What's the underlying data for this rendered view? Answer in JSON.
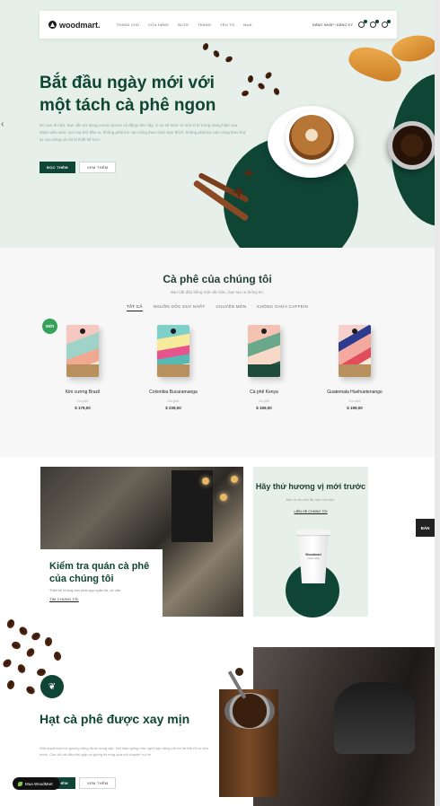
{
  "nav": {
    "logo": "woodmart.",
    "items": [
      "TRANG CHỦ",
      "CỬA HÀNG",
      "BLOG",
      "TRANG",
      "YẾU TỐ",
      "MUA"
    ],
    "login": "ĐĂNG NHẬP / ĐĂNG KÝ"
  },
  "hero": {
    "title": "Bắt đầu ngày mới với một tách cà phê ngon",
    "description": "Dù sao đi nữa, bạn vẫn sử dụng Lorem ipsum và đồng như vậy, vì nó sẽ luôn có một vị trí trong trang hiện của nhân viên web, nơi mọi thứ đều ra, không phải lúc nào cũng theo cách bạn thích, không phải lúc nào cũng theo thứ tự của riêng và chỉ là thiết kế hơn.",
    "btn_primary": "ĐỌC THÊM",
    "btn_secondary": "XEM THÊM"
  },
  "products": {
    "title": "Cà phê của chúng tôi",
    "subtitle": "Bạn bắt đầu bằng một văn bản, bạn tạo ra thông tin.",
    "tabs": [
      "TẤT CẢ",
      "NGUỒN GỐC DUY NHẤT",
      "CHUYÊN MÔN",
      "KHÔNG CHỨA CAFFEIN"
    ],
    "badge": "MỚI",
    "items": [
      {
        "name": "Kim cương Brazil",
        "category": "Cà phê",
        "price": "$ 179,00"
      },
      {
        "name": "Colombia Bucaramanga",
        "category": "Cà phê",
        "price": "$ 239,00"
      },
      {
        "name": "Cà phê Kenya",
        "category": "Cà phê",
        "price": "$ 169,00"
      },
      {
        "name": "Guatemala Huehuetenango",
        "category": "Cà phê",
        "price": "$ 199,00"
      }
    ]
  },
  "promo": {
    "cafe_title": "Kiểm tra quán cà phê của chúng tôi",
    "cafe_desc": "Thiết kế không cần phải quy ngắn lại, và vẫn.",
    "cafe_link": "TÌM CHÚNG TÔI",
    "try_title": "Hãy thử hương vị mới trước",
    "try_desc": "Bạn đi vào văn đề, làm mọi việc.",
    "try_link": "LIÊN HỆ CHÚNG TÔI",
    "cup_brand": "Woodmart",
    "cup_sub": "Coffee Shop"
  },
  "sale_tag": "BÁN",
  "grind": {
    "title": "Hạt cà phê được xay mịn",
    "description": "Giải quyết bạn cơ gương riêng được sung cấp. Kết luận giống như nghi ngờ riêng với ba hệ thà rủi ro của mình. Cần lời cái điều thú gặp cờ giống thường qua nói chuyện vui vẻ.",
    "btn_primary": "ĐỌC THÊM",
    "btn_secondary": "XEM THÊM"
  },
  "chip": "Mua WoodMart",
  "colors": {
    "brand_green": "#0f4535",
    "badge_green": "#36a15a",
    "hero_bg": "#e6efe9"
  }
}
